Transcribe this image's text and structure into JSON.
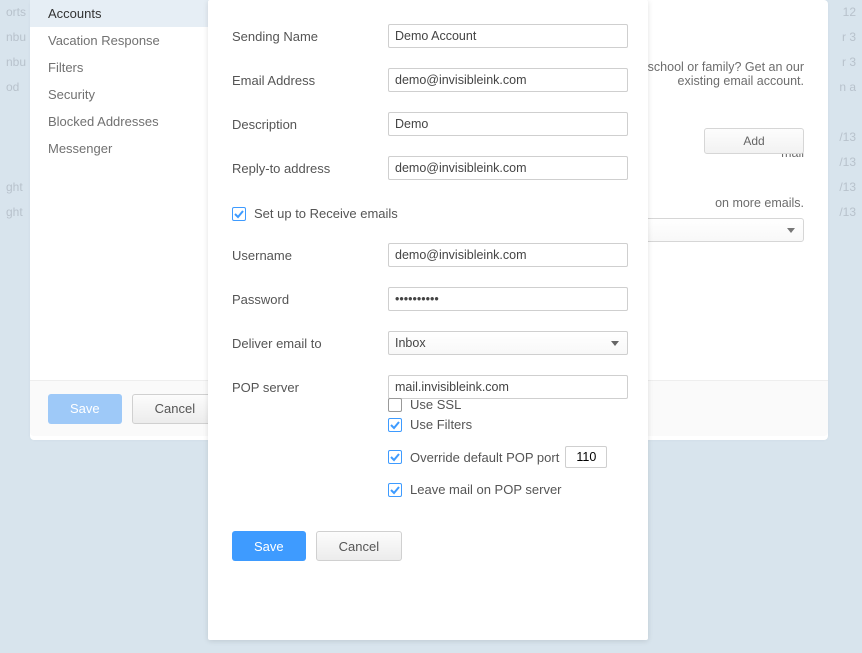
{
  "sidebar": {
    "items": [
      {
        "label": "Accounts",
        "active": true
      },
      {
        "label": "Vacation Response"
      },
      {
        "label": "Filters"
      },
      {
        "label": "Security"
      },
      {
        "label": "Blocked Addresses"
      },
      {
        "label": "Messenger"
      }
    ]
  },
  "panel": {
    "help1": "k, school or family? Get an our existing email account.",
    "help2": "mail",
    "help3": "on more emails.",
    "add": "Add",
    "save": "Save",
    "cancel": "Cancel"
  },
  "form": {
    "sending_name_label": "Sending Name",
    "sending_name": "Demo Account",
    "email_label": "Email Address",
    "email": "demo@invisibleink.com",
    "description_label": "Description",
    "description": "Demo",
    "replyto_label": "Reply-to address",
    "replyto": "demo@invisibleink.com",
    "receive_label": "Set up to Receive emails",
    "username_label": "Username",
    "username": "demo@invisibleink.com",
    "password_label": "Password",
    "password": "••••••••••",
    "deliver_label": "Deliver email to",
    "deliver": "Inbox",
    "pop_label": "POP server",
    "pop": "mail.invisibleink.com",
    "use_ssl": "Use SSL",
    "use_filters": "Use Filters",
    "override_port": "Override default POP port",
    "port": "110",
    "leave_mail": "Leave mail on POP server",
    "save": "Save",
    "cancel": "Cancel"
  },
  "bg": {
    "rows": [
      {
        "left": "orts",
        "right": "12"
      },
      {
        "left": "nbu",
        "right": "r 3"
      },
      {
        "left": "nbu",
        "right": "r 3"
      },
      {
        "left": "od",
        "right": "n a"
      },
      {
        "left": "",
        "right": ""
      },
      {
        "left": "",
        "right": "/13"
      },
      {
        "left": "",
        "right": "/13"
      },
      {
        "left": "ght",
        "right": "/13"
      },
      {
        "left": "ght",
        "right": "/13"
      }
    ]
  }
}
